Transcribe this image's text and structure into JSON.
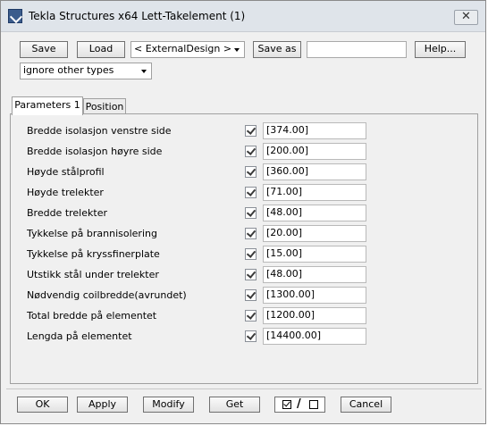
{
  "window": {
    "title": "Tekla Structures x64  Lett-Takelement (1)",
    "close_glyph": "✕"
  },
  "toolbar": {
    "save_label": "Save",
    "load_label": "Load",
    "attribute_file": "< ExternalDesign >",
    "save_as_label": "Save as",
    "save_as_value": "",
    "help_label": "Help...",
    "filter_option": "ignore other types"
  },
  "tabs": [
    {
      "label": "Parameters 1",
      "active": true
    },
    {
      "label": "Position",
      "active": false
    }
  ],
  "parameters": [
    {
      "label": "Bredde isolasjon venstre side",
      "checked": true,
      "value": "[374.00]"
    },
    {
      "label": "Bredde isolasjon høyre side",
      "checked": true,
      "value": "[200.00]"
    },
    {
      "label": "Høyde stålprofil",
      "checked": true,
      "value": "[360.00]"
    },
    {
      "label": "Høyde trelekter",
      "checked": true,
      "value": "[71.00]"
    },
    {
      "label": "Bredde trelekter",
      "checked": true,
      "value": "[48.00]"
    },
    {
      "label": "Tykkelse på brannisolering",
      "checked": true,
      "value": "[20.00]"
    },
    {
      "label": "Tykkelse på kryssfinerplate",
      "checked": true,
      "value": "[15.00]"
    },
    {
      "label": "Utstikk stål under trelekter",
      "checked": true,
      "value": "[48.00]"
    },
    {
      "label": "Nødvendig coilbredde(avrundet)",
      "checked": true,
      "value": "[1300.00]"
    },
    {
      "label": "Total bredde på elementet",
      "checked": true,
      "value": "[1200.00]"
    },
    {
      "label": "Lengda på elementet",
      "checked": true,
      "value": "[14400.00]"
    }
  ],
  "footer": {
    "ok_label": "OK",
    "apply_label": "Apply",
    "modify_label": "Modify",
    "get_label": "Get",
    "toggle_separator": "/",
    "cancel_label": "Cancel"
  }
}
